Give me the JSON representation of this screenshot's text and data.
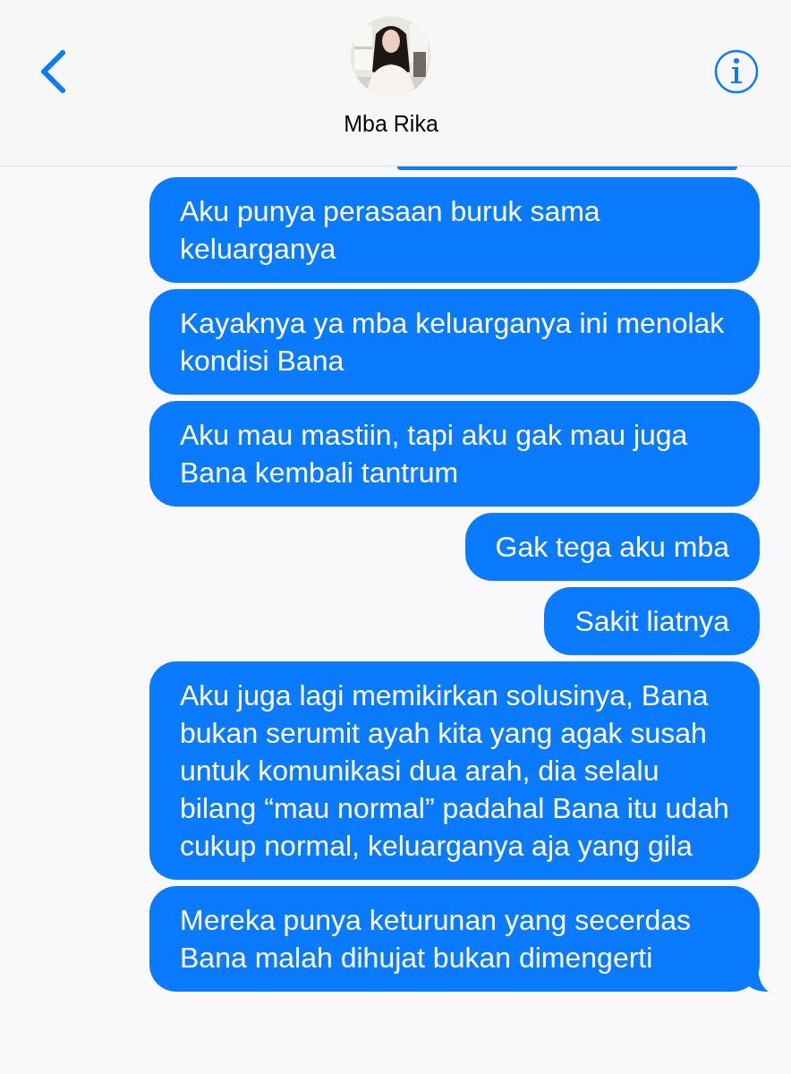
{
  "header": {
    "contact_name": "Mba Rika"
  },
  "messages": [
    {
      "text": "Aku punya perasaan buruk sama keluarganya",
      "tail": false
    },
    {
      "text": "Kayaknya ya mba keluarganya ini menolak kondisi Bana",
      "tail": false
    },
    {
      "text": "Aku mau mastiin, tapi aku gak mau juga Bana kembali tantrum",
      "tail": false
    },
    {
      "text": "Gak tega aku mba",
      "tail": false
    },
    {
      "text": "Sakit liatnya",
      "tail": false
    },
    {
      "text": "Aku juga lagi memikirkan solusinya, Bana bukan serumit ayah kita yang agak susah untuk komunikasi dua arah, dia selalu bilang “mau normal” padahal Bana itu udah cukup normal, keluarganya aja yang gila",
      "tail": false
    },
    {
      "text": "Mereka punya keturunan yang secerdas Bana malah dihujat bukan dimengerti",
      "tail": true
    }
  ]
}
